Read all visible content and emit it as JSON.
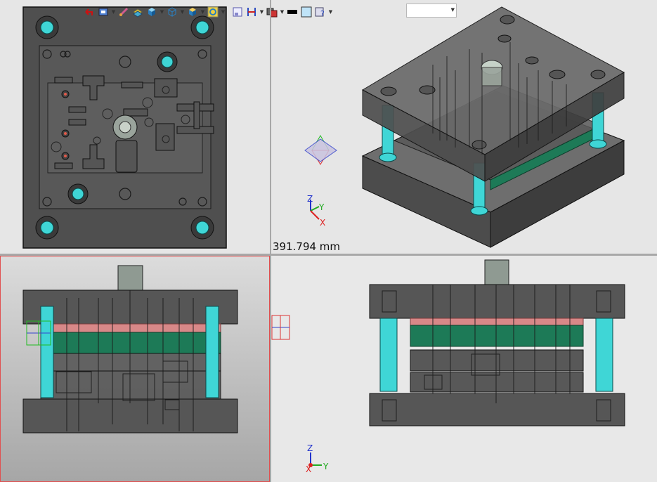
{
  "measure": {
    "value": "391.794 mm"
  },
  "toolbar": {
    "icons": [
      "undo-arrow-icon",
      "view-display-icon",
      "brush-icon",
      "stack-layers-icon",
      "shaded-cube-icon",
      "wireframe-cube-icon",
      "render-cube-icon",
      "ring-icon",
      "window-icon",
      "section-icon",
      "views-icon",
      "black-fill-icon",
      "light-fill-icon",
      "help-icon"
    ],
    "dropdown_value": ""
  },
  "axes": {
    "iso": {
      "z": "Z",
      "y": "Y",
      "x": "X"
    },
    "right": {
      "z": "Z",
      "x": "X",
      "y": "Y"
    }
  },
  "colors": {
    "guide_pillar": "#3fd6d6",
    "steel": "#5c5c5c",
    "plate_green": "#1d7a57",
    "plate_red": "#d88888",
    "active_border": "#e05050"
  }
}
